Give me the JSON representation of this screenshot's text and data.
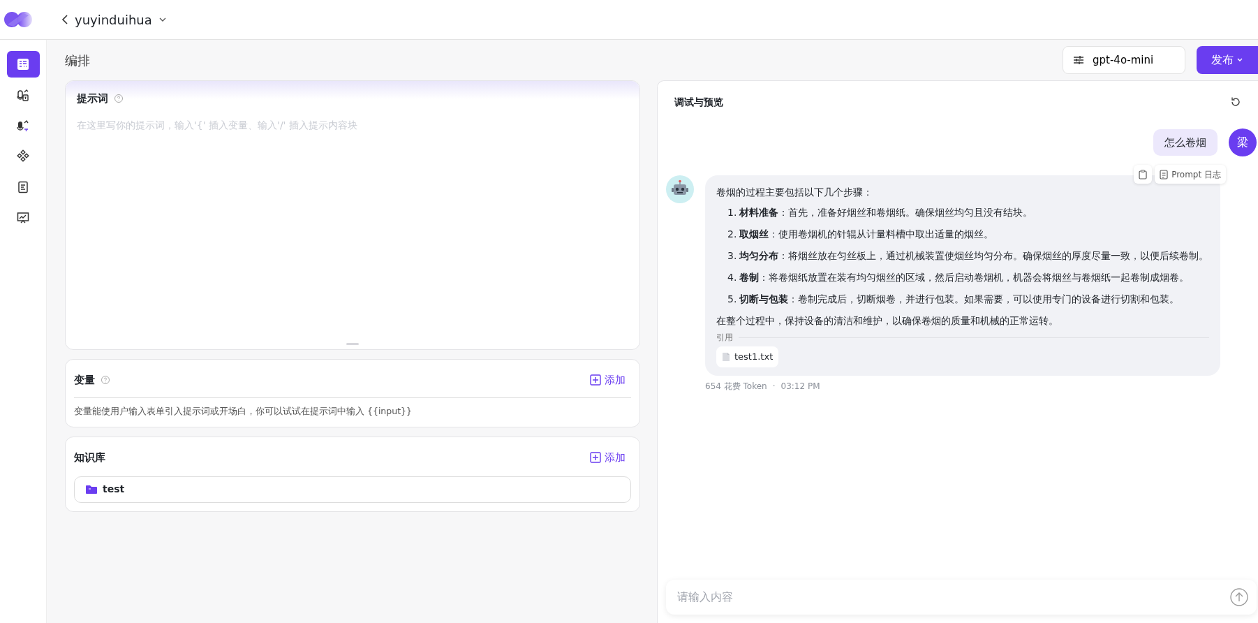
{
  "header": {
    "app_title": "yuyinduihua"
  },
  "sidebar": {
    "items": [
      {
        "selected": true
      },
      {
        "selected": false
      },
      {
        "selected": false
      },
      {
        "selected": false
      },
      {
        "selected": false
      },
      {
        "selected": false
      }
    ]
  },
  "page_title": "编排",
  "toolbar": {
    "model": "gpt-4o-mini",
    "publish": "发布"
  },
  "prompt": {
    "title": "提示词",
    "placeholder": "在这里写你的提示词，输入'{' 插入变量、输入'/' 插入提示内容块"
  },
  "variables": {
    "title": "变量",
    "add": "添加",
    "hint": "变量能使用户输入表单引入提示词或开场白，你可以试试在提示词中输入 {{input}}"
  },
  "knowledge": {
    "title": "知识库",
    "add": "添加",
    "items": [
      {
        "name": "test"
      }
    ]
  },
  "preview": {
    "title": "调试与预览",
    "messages": [
      {
        "kind": "user",
        "text": "怎么卷烟",
        "avatar": "梁"
      },
      {
        "kind": "bot",
        "actions": {
          "log": "Prompt 日志"
        },
        "intro": "卷烟的过程主要包括以下几个步骤：",
        "steps": [
          {
            "number": "1.",
            "text": "**材料准备**：首先，准备好烟丝和卷烟纸。确保烟丝均匀且没有结块。"
          },
          {
            "number": "2.",
            "text": "**取烟丝**：使用卷烟机的针辊从计量料槽中取出适量的烟丝。"
          },
          {
            "number": "3.",
            "text": "**均匀分布**：将烟丝放在匀丝板上，通过机械装置使烟丝均匀分布。确保烟丝的厚度尽量一致，以便后续卷制。"
          },
          {
            "number": "4.",
            "text": "**卷制**：将卷烟纸放置在装有均匀烟丝的区域，然后启动卷烟机，机器会将烟丝与卷烟纸一起卷制成烟卷。"
          },
          {
            "number": "5.",
            "text": "**切断与包装**：卷制完成后，切断烟卷，并进行包装。如果需要，可以使用专门的设备进行切割和包装。"
          }
        ],
        "outro": "在整个过程中，保持设备的清洁和维护，以确保卷烟的质量和机械的正常运转。",
        "citation_label": "引用",
        "citations": [
          "test1.txt"
        ],
        "tokens": "654 花费 Token",
        "separator": "·",
        "time": "03:12 PM"
      }
    ],
    "input_placeholder": "请输入内容"
  }
}
